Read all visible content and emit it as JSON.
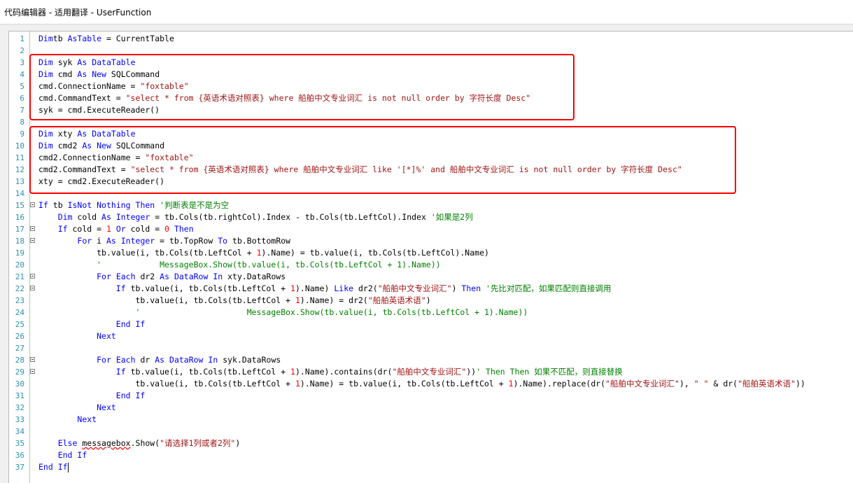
{
  "window": {
    "title": "代码编辑器 - 适用翻译 - UserFunction"
  },
  "colors": {
    "keyword": "#0000ff",
    "string": "#a31515",
    "comment": "#008000",
    "number": "#ff0000",
    "line_number": "#2b91af",
    "highlight_box": "#ff0000"
  },
  "editor": {
    "lines": [
      {
        "n": "1",
        "indent": "",
        "tokens": [
          [
            "kw",
            "Dim"
          ],
          [
            "",
            "tb "
          ],
          [
            "kw",
            "As"
          ],
          [
            "",
            ""
          ],
          [
            "ty",
            "Table"
          ],
          [
            "",
            " = CurrentTable"
          ]
        ]
      },
      {
        "n": "2",
        "indent": "",
        "tokens": []
      },
      {
        "n": "3",
        "indent": "",
        "tokens": [
          [
            "kw",
            "Dim"
          ],
          [
            "",
            " syk "
          ],
          [
            "kw",
            "As"
          ],
          [
            "",
            " "
          ],
          [
            "ty",
            "DataTable"
          ]
        ]
      },
      {
        "n": "4",
        "indent": "",
        "tokens": [
          [
            "kw",
            "Dim"
          ],
          [
            "",
            " cmd "
          ],
          [
            "kw",
            "As"
          ],
          [
            "",
            " "
          ],
          [
            "kw",
            "New"
          ],
          [
            "",
            " SQLCommand"
          ]
        ]
      },
      {
        "n": "5",
        "indent": "",
        "tokens": [
          [
            "",
            "cmd.ConnectionName = "
          ],
          [
            "str",
            "\"foxtable\""
          ]
        ]
      },
      {
        "n": "6",
        "indent": "",
        "tokens": [
          [
            "",
            "cmd.CommandText = "
          ],
          [
            "str",
            "\"select * from {英语术语对照表} where 船舶中文专业词汇 is not null order by 字符长度 Desc\""
          ]
        ]
      },
      {
        "n": "7",
        "indent": "",
        "tokens": [
          [
            "",
            "syk = cmd.ExecuteReader()"
          ]
        ]
      },
      {
        "n": "8",
        "indent": "",
        "tokens": []
      },
      {
        "n": "9",
        "indent": "",
        "tokens": [
          [
            "kw",
            "Dim"
          ],
          [
            "",
            " xty "
          ],
          [
            "kw",
            "As"
          ],
          [
            "",
            " "
          ],
          [
            "ty",
            "DataTable"
          ]
        ]
      },
      {
        "n": "10",
        "indent": "",
        "tokens": [
          [
            "kw",
            "Dim"
          ],
          [
            "",
            " cmd2 "
          ],
          [
            "kw",
            "As"
          ],
          [
            "",
            " "
          ],
          [
            "kw",
            "New"
          ],
          [
            "",
            " SQLCommand"
          ]
        ]
      },
      {
        "n": "11",
        "indent": "",
        "tokens": [
          [
            "",
            "cmd2.ConnectionName = "
          ],
          [
            "str",
            "\"foxtable\""
          ]
        ]
      },
      {
        "n": "12",
        "indent": "",
        "tokens": [
          [
            "",
            "cmd2.CommandText = "
          ],
          [
            "str",
            "\"select * from {英语术语对照表} where 船舶中文专业词汇 like '[*]%' and 船舶中文专业词汇 is not null order by 字符长度 Desc\""
          ]
        ]
      },
      {
        "n": "13",
        "indent": "",
        "tokens": [
          [
            "",
            "xty = cmd2.ExecuteReader()"
          ]
        ]
      },
      {
        "n": "14",
        "indent": "",
        "tokens": []
      },
      {
        "n": "15",
        "indent": "",
        "fold": true,
        "tokens": [
          [
            "kw",
            "If"
          ],
          [
            "",
            " tb "
          ],
          [
            "kw",
            "IsNot"
          ],
          [
            "",
            " "
          ],
          [
            "kw",
            "Nothing"
          ],
          [
            "",
            " "
          ],
          [
            "kw",
            "Then"
          ],
          [
            "",
            " "
          ],
          [
            "cm",
            "'判断表是不是为空"
          ]
        ]
      },
      {
        "n": "16",
        "indent": "    ",
        "tokens": [
          [
            "kw",
            "Dim"
          ],
          [
            "",
            " cold "
          ],
          [
            "kw",
            "As"
          ],
          [
            "",
            " "
          ],
          [
            "ty",
            "Integer"
          ],
          [
            "",
            " = tb.Cols(tb.rightCol).Index - tb.Cols(tb.LeftCol).Index "
          ],
          [
            "cm",
            "'如果是2列"
          ]
        ]
      },
      {
        "n": "17",
        "indent": "    ",
        "fold": true,
        "tokens": [
          [
            "kw",
            "If"
          ],
          [
            "",
            " cold = "
          ],
          [
            "num",
            "1"
          ],
          [
            "",
            " "
          ],
          [
            "kw",
            "Or"
          ],
          [
            "",
            " cold = "
          ],
          [
            "num",
            "0"
          ],
          [
            "",
            " "
          ],
          [
            "kw",
            "Then"
          ]
        ]
      },
      {
        "n": "18",
        "indent": "        ",
        "fold": true,
        "tokens": [
          [
            "kw",
            "For"
          ],
          [
            "",
            " i "
          ],
          [
            "kw",
            "As"
          ],
          [
            "",
            " "
          ],
          [
            "ty",
            "Integer"
          ],
          [
            "",
            " = tb.TopRow "
          ],
          [
            "kw",
            "To"
          ],
          [
            "",
            " tb.BottomRow"
          ]
        ]
      },
      {
        "n": "19",
        "indent": "            ",
        "tokens": [
          [
            "",
            "tb.value(i, tb.Cols(tb.LeftCol + "
          ],
          [
            "num",
            "1"
          ],
          [
            "",
            ").Name) = tb.value(i, tb.Cols(tb.LeftCol).Name)"
          ]
        ]
      },
      {
        "n": "20",
        "indent": "            ",
        "tokens": [
          [
            "cm",
            "'            MessageBox.Show(tb.value(i, tb.Cols(tb.LeftCol + 1).Name))"
          ]
        ]
      },
      {
        "n": "21",
        "indent": "            ",
        "fold": true,
        "tokens": [
          [
            "kw",
            "For"
          ],
          [
            "",
            " "
          ],
          [
            "kw",
            "Each"
          ],
          [
            "",
            " dr2 "
          ],
          [
            "kw",
            "As"
          ],
          [
            "",
            " "
          ],
          [
            "ty",
            "DataRow"
          ],
          [
            "",
            " "
          ],
          [
            "kw",
            "In"
          ],
          [
            "",
            " xty.DataRows"
          ]
        ]
      },
      {
        "n": "22",
        "indent": "                ",
        "fold": true,
        "tokens": [
          [
            "kw",
            "If"
          ],
          [
            "",
            " tb.value(i, tb.Cols(tb.LeftCol + "
          ],
          [
            "num",
            "1"
          ],
          [
            "",
            ").Name) "
          ],
          [
            "kw",
            "Like"
          ],
          [
            "",
            " dr2("
          ],
          [
            "str",
            "\"船舶中文专业词汇\""
          ],
          [
            "",
            ") "
          ],
          [
            "kw",
            "Then"
          ],
          [
            "",
            " "
          ],
          [
            "cm",
            "'先比对匹配，如果匹配则直接调用"
          ]
        ]
      },
      {
        "n": "23",
        "indent": "                    ",
        "tokens": [
          [
            "",
            "tb.value(i, tb.Cols(tb.LeftCol + "
          ],
          [
            "num",
            "1"
          ],
          [
            "",
            ").Name) = dr2("
          ],
          [
            "str",
            "\"船舶英语术语\""
          ],
          [
            "",
            ")"
          ]
        ]
      },
      {
        "n": "24",
        "indent": "                    ",
        "tokens": [
          [
            "cm",
            "'                      MessageBox.Show(tb.value(i, tb.Cols(tb.LeftCol + 1).Name))"
          ]
        ]
      },
      {
        "n": "25",
        "indent": "                ",
        "tokens": [
          [
            "kw",
            "End If"
          ]
        ]
      },
      {
        "n": "26",
        "indent": "            ",
        "tokens": [
          [
            "kw",
            "Next"
          ]
        ]
      },
      {
        "n": "27",
        "indent": "",
        "tokens": []
      },
      {
        "n": "28",
        "indent": "            ",
        "fold": true,
        "tokens": [
          [
            "kw",
            "For"
          ],
          [
            "",
            " "
          ],
          [
            "kw",
            "Each"
          ],
          [
            "",
            " dr "
          ],
          [
            "kw",
            "As"
          ],
          [
            "",
            " "
          ],
          [
            "ty",
            "DataRow"
          ],
          [
            "",
            " "
          ],
          [
            "kw",
            "In"
          ],
          [
            "",
            " syk.DataRows"
          ]
        ]
      },
      {
        "n": "29",
        "indent": "                ",
        "fold": true,
        "tokens": [
          [
            "kw",
            "If"
          ],
          [
            "",
            " tb.value(i, tb.Cols(tb.LeftCol + "
          ],
          [
            "num",
            "1"
          ],
          [
            "",
            ").Name).contains(dr("
          ],
          [
            "str",
            "\"船舶中文专业词汇\""
          ],
          [
            "",
            "))"
          ],
          [
            "cm",
            "' Then Then 如果不匹配，则直接替换"
          ]
        ]
      },
      {
        "n": "30",
        "indent": "                    ",
        "tokens": [
          [
            "",
            "tb.value(i, tb.Cols(tb.LeftCol + "
          ],
          [
            "num",
            "1"
          ],
          [
            "",
            ").Name) = tb.value(i, tb.Cols(tb.LeftCol + "
          ],
          [
            "num",
            "1"
          ],
          [
            "",
            ").Name).replace(dr("
          ],
          [
            "str",
            "\"船舶中文专业词汇\""
          ],
          [
            "",
            "), "
          ],
          [
            "str",
            "\" \""
          ],
          [
            "",
            " & dr("
          ],
          [
            "str",
            "\"船舶英语术语\""
          ],
          [
            "",
            "))"
          ]
        ]
      },
      {
        "n": "31",
        "indent": "                ",
        "tokens": [
          [
            "kw",
            "End If"
          ]
        ]
      },
      {
        "n": "32",
        "indent": "            ",
        "tokens": [
          [
            "kw",
            "Next"
          ]
        ]
      },
      {
        "n": "33",
        "indent": "        ",
        "tokens": [
          [
            "kw",
            "Next"
          ]
        ]
      },
      {
        "n": "34",
        "indent": "",
        "tokens": []
      },
      {
        "n": "35",
        "indent": "    ",
        "tokens": [
          [
            "kw",
            "Else"
          ],
          [
            "",
            " "
          ],
          [
            "sq",
            "messagebox"
          ],
          [
            "",
            ".Show("
          ],
          [
            "str",
            "\"请选择1列或者2列\""
          ],
          [
            "",
            ")"
          ]
        ]
      },
      {
        "n": "36",
        "indent": "    ",
        "tokens": [
          [
            "kw",
            "End If"
          ]
        ]
      },
      {
        "n": "37",
        "indent": "",
        "caret": true,
        "tokens": [
          [
            "kw",
            "End If"
          ]
        ]
      }
    ]
  }
}
